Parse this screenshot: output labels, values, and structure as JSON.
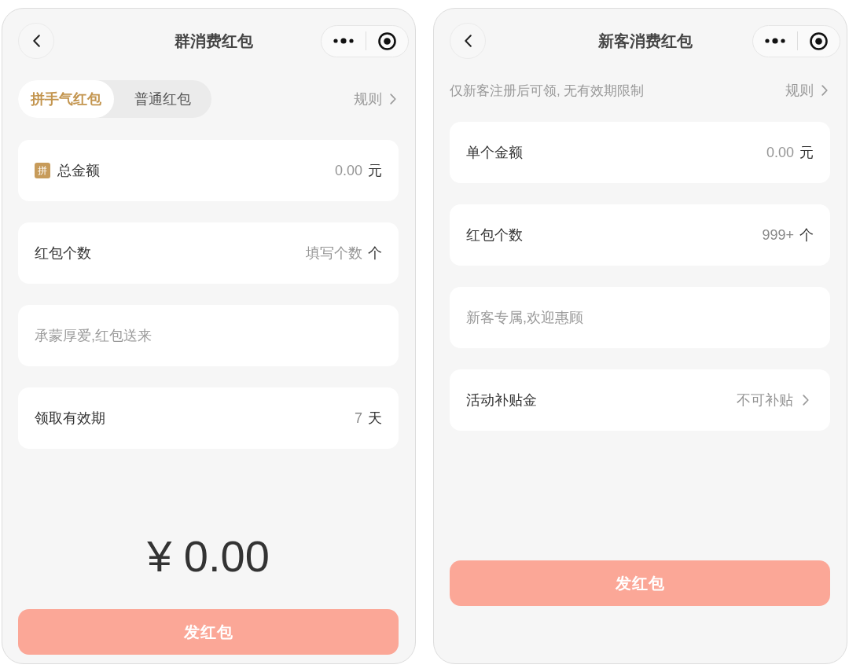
{
  "screens": [
    {
      "nav": {
        "title": "群消费红包"
      },
      "tabs": [
        {
          "label": "拼手气红包",
          "selected": true
        },
        {
          "label": "普通红包",
          "selected": false
        }
      ],
      "rules_link": "规则",
      "rows": [
        {
          "kind": "input",
          "badge": "拼",
          "label": "总金额",
          "placeholder": "0.00",
          "unit": "元"
        },
        {
          "kind": "input",
          "label": "红包个数",
          "placeholder": "填写个数",
          "unit": "个"
        },
        {
          "kind": "message",
          "placeholder": "承蒙厚爱,红包送来"
        },
        {
          "kind": "input",
          "label": "领取有效期",
          "value": "7",
          "unit": "天"
        }
      ],
      "total": "¥ 0.00",
      "submit_button": "发红包"
    },
    {
      "nav": {
        "title": "新客消费红包"
      },
      "notice": "仅新客注册后可领, 无有效期限制",
      "rules_link": "规则",
      "rows": [
        {
          "kind": "input",
          "label": "单个金额",
          "placeholder": "0.00",
          "unit": "元"
        },
        {
          "kind": "input",
          "label": "红包个数",
          "value": "999+",
          "unit": "个"
        },
        {
          "kind": "message",
          "placeholder": "新客专属,欢迎惠顾"
        },
        {
          "kind": "select",
          "label": "活动补贴金",
          "value": "不可补贴"
        }
      ],
      "submit_button": "发红包"
    }
  ]
}
